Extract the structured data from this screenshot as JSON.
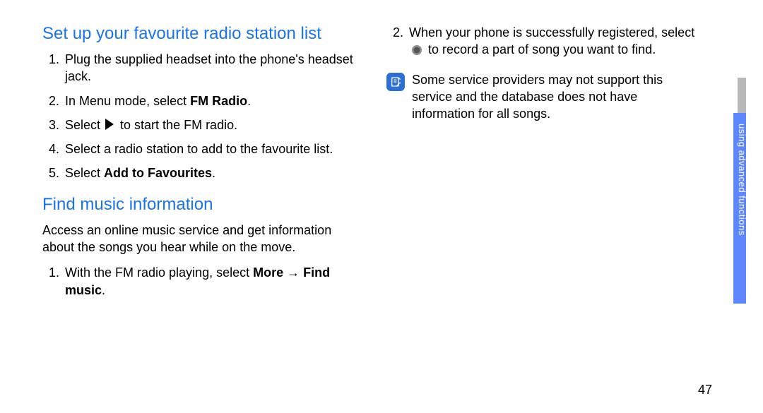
{
  "left": {
    "heading1": "Set up your favourite radio station list",
    "steps1": {
      "s1": "Plug the supplied headset into the phone's headset jack.",
      "s2a": "In Menu mode, select ",
      "s2b_bold": "FM Radio",
      "s2c": ".",
      "s3a": "Select ",
      "s3b": " to start the FM radio.",
      "s4": "Select a radio station to add to the favourite list.",
      "s5a": "Select ",
      "s5b_bold": "Add to Favourites",
      "s5c": "."
    },
    "heading2": "Find music information",
    "intro2": "Access an online music service and get information about the songs you hear while on the move.",
    "steps2": {
      "s1a": "With the FM radio playing, select ",
      "s1b_bold": "More",
      "s1c": " → ",
      "s1d_bold": "Find music",
      "s1e": "."
    }
  },
  "right": {
    "step2a": "When your phone is successfully registered, select ",
    "step2b": " to record a part of song you want to find.",
    "note": "Some service providers may not support this service and the database does not have information for all songs."
  },
  "side_label": "using advanced functions",
  "page_number": "47"
}
